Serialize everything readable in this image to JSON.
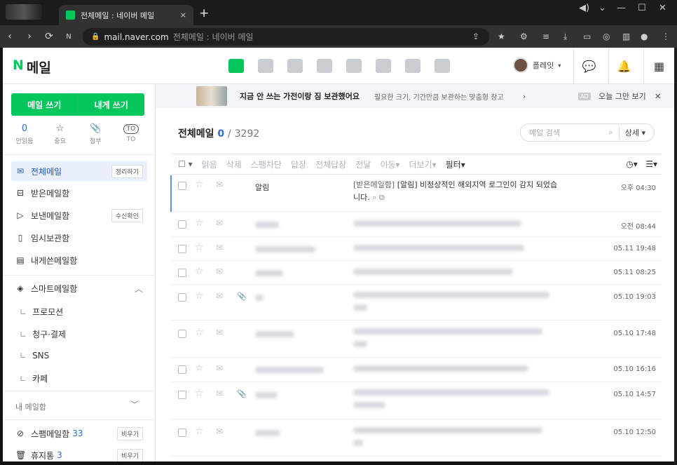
{
  "browser": {
    "tab_title": "전체메일 : 네이버 메일",
    "tab_close": "×",
    "new_tab": "+",
    "domain": "mail.naver.com",
    "page_title": "전체메일 : 네이버 메일"
  },
  "app": {
    "logo_n": "N",
    "logo_text": "메일",
    "profile_name": "플레잇",
    "accent_color": "#03c75a"
  },
  "sidebar": {
    "write_mail": "메일 쓰기",
    "write_self": "내게 쓰기",
    "quick": [
      {
        "top": "0",
        "label": "안읽음"
      },
      {
        "top": "☆",
        "label": "중요"
      },
      {
        "top": "📎",
        "label": "첨부"
      },
      {
        "top": "TO",
        "label": "TO"
      }
    ],
    "folders": {
      "all": {
        "label": "전체메일",
        "action": "정리하기"
      },
      "inbox": {
        "label": "받은메일함"
      },
      "sent": {
        "label": "보낸메일함",
        "action": "수신확인"
      },
      "drafts": {
        "label": "임시보관함"
      },
      "self": {
        "label": "내게쓴메일함"
      },
      "smart": {
        "label": "스마트메일함"
      },
      "spam": {
        "label": "스팸메일함",
        "count": "33",
        "action": "비우기"
      },
      "trash": {
        "label": "휴지통",
        "count": "3",
        "action": "비우기"
      }
    },
    "smart_sub": [
      "프로모션",
      "청구·결제",
      "SNS",
      "카페"
    ],
    "my_folders": "내 메일함"
  },
  "promo": {
    "title": "지금 안 쓰는 가전이랑 짐 보관했어요",
    "subtitle": "필요한 크기, 기간만큼 보관하는 맞춤형 창고",
    "ad": "AD",
    "close_today": "오늘 그만 보기"
  },
  "list": {
    "title": "전체메일",
    "unread": "0",
    "separator": "/",
    "total": "3292",
    "search_placeholder": "메일 검색",
    "search_detail": "상세",
    "toolbar": [
      "읽음",
      "삭제",
      "스팸차단",
      "답장",
      "전체답장",
      "전달",
      "이동",
      "더보기"
    ],
    "filter": "필터",
    "rows": [
      {
        "from": "알림",
        "prefix": "[받은메일함]",
        "subject": "[알림] 비정상적인 해외지역 로그인이 감지 되었습니다.",
        "date": "오후 04:30"
      },
      {
        "date": "오전 08:44"
      },
      {
        "date": "05.11 19:48"
      },
      {
        "date": "05.11 08:25"
      },
      {
        "date": "05.10 19:03"
      },
      {
        "date": "05.10 17:48"
      },
      {
        "date": "05.10 16:16"
      },
      {
        "date": "05.10 14:57"
      },
      {
        "date": "05.10 12:50"
      }
    ]
  }
}
